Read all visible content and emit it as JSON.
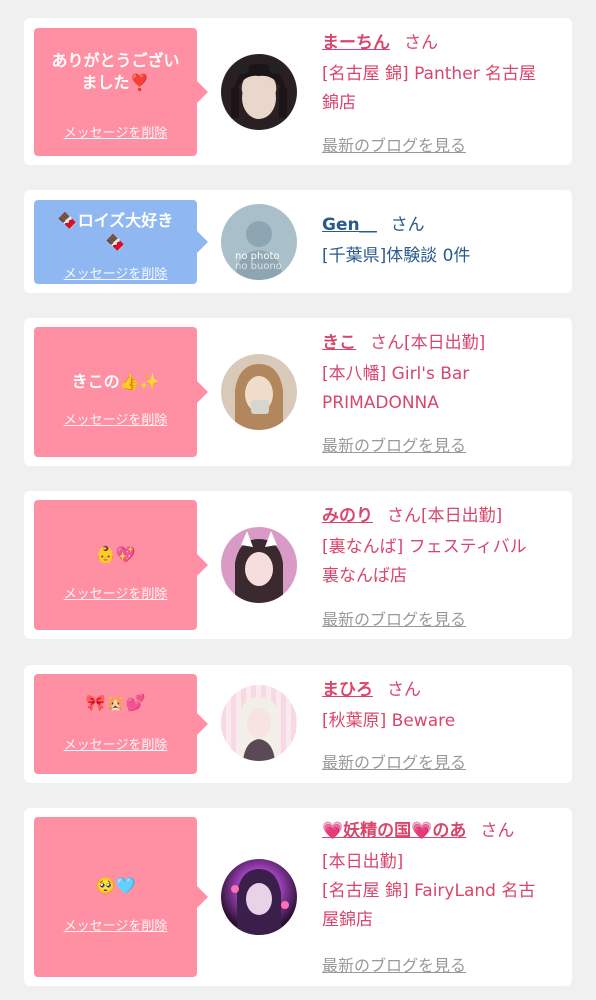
{
  "items": [
    {
      "message_line1": "ありがとうござい",
      "message_line2": "ました❣️",
      "delete_label": "メッセージを削除",
      "name": "まーちん",
      "honorific": "さん",
      "status": "",
      "shop_line1": "[名古屋 錦] Panther 名古屋",
      "shop_line2": "錦店",
      "blog_link": "最新のブログを見る"
    },
    {
      "message_line1": "🍫ロイズ大好き",
      "message_line2": "🍫",
      "delete_label": "メッセージを削除",
      "name": "Gen＿",
      "honorific": "さん",
      "status": "",
      "shop_line1": "[千葉県]体験談 0件",
      "avatar_text1": "no photo",
      "avatar_text2": "no buono"
    },
    {
      "message_line1": "きこの👍✨",
      "delete_label": "メッセージを削除",
      "name": "きこ",
      "honorific": "さん",
      "status": "[本日出勤]",
      "shop_line1": "[本八幡] Girl's Bar",
      "shop_line2": "PRIMADONNA",
      "blog_link": "最新のブログを見る"
    },
    {
      "message_line1": "👶💖",
      "delete_label": "メッセージを削除",
      "name": "みのり",
      "honorific": "さん",
      "status": "[本日出勤]",
      "shop_line1": "[裏なんば] フェスティバル",
      "shop_line2": "裏なんば店",
      "blog_link": "最新のブログを見る"
    },
    {
      "message_line1": "🎀🐹💕",
      "delete_label": "メッセージを削除",
      "name": "まひろ",
      "honorific": "さん",
      "status": "",
      "shop_line1": "[秋葉原] Beware",
      "blog_link": "最新のブログを見る"
    },
    {
      "message_line1": "🥺🩵",
      "delete_label": "メッセージを削除",
      "name": "💗妖精の国💗のあ",
      "honorific": "さん",
      "status": "",
      "shop_line1": "[本日出勤]",
      "shop_line2": "[名古屋 錦] FairyLand 名古",
      "shop_line3": "屋錦店",
      "blog_link": "最新のブログを見る"
    }
  ]
}
